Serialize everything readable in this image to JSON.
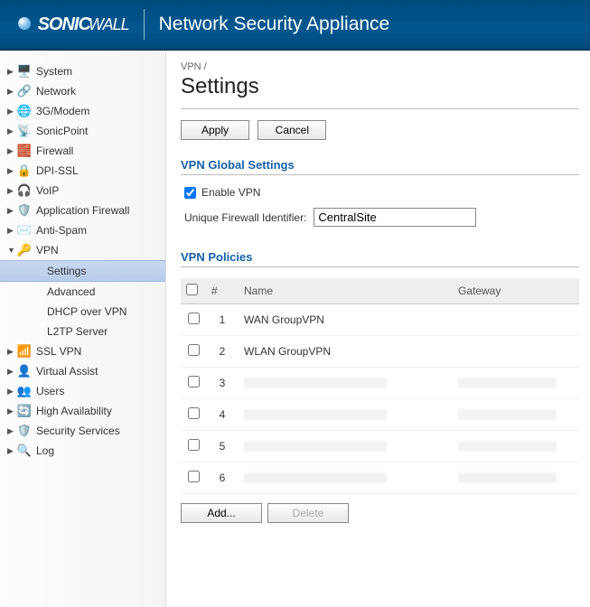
{
  "header": {
    "brand": "SONIC",
    "brand_suffix": "WALL",
    "subtitle": "Network Security Appliance"
  },
  "sidebar": {
    "items": [
      {
        "label": "System",
        "icon": "🖥️"
      },
      {
        "label": "Network",
        "icon": "🔗"
      },
      {
        "label": "3G/Modem",
        "icon": "🌐"
      },
      {
        "label": "SonicPoint",
        "icon": "📡"
      },
      {
        "label": "Firewall",
        "icon": "🧱"
      },
      {
        "label": "DPI-SSL",
        "icon": "🔒"
      },
      {
        "label": "VoIP",
        "icon": "🎧"
      },
      {
        "label": "Application Firewall",
        "icon": "🛡️"
      },
      {
        "label": "Anti-Spam",
        "icon": "✉️"
      },
      {
        "label": "VPN",
        "icon": "🔑",
        "expanded": true,
        "subs": [
          {
            "label": "Settings",
            "active": true
          },
          {
            "label": "Advanced"
          },
          {
            "label": "DHCP over VPN"
          },
          {
            "label": "L2TP Server"
          }
        ]
      },
      {
        "label": "SSL VPN",
        "icon": "📶"
      },
      {
        "label": "Virtual Assist",
        "icon": "👤"
      },
      {
        "label": "Users",
        "icon": "👥"
      },
      {
        "label": "High Availability",
        "icon": "🔄"
      },
      {
        "label": "Security Services",
        "icon": "🛡️"
      },
      {
        "label": "Log",
        "icon": "🔍"
      }
    ]
  },
  "main": {
    "breadcrumb": "VPN /",
    "title": "Settings",
    "buttons": {
      "apply": "Apply",
      "cancel": "Cancel"
    },
    "global": {
      "heading": "VPN Global Settings",
      "enable_label": "Enable VPN",
      "enable_checked": true,
      "uid_label": "Unique Firewall Identifier:",
      "uid_value": "CentralSite"
    },
    "policies": {
      "heading": "VPN Policies",
      "columns": {
        "num": "#",
        "name": "Name",
        "gateway": "Gateway"
      },
      "rows": [
        {
          "num": "1",
          "name": "WAN GroupVPN",
          "gateway": "",
          "redacted": false
        },
        {
          "num": "2",
          "name": "WLAN GroupVPN",
          "gateway": "",
          "redacted": false
        },
        {
          "num": "3",
          "name": "",
          "gateway": "",
          "redacted": true
        },
        {
          "num": "4",
          "name": "",
          "gateway": "",
          "redacted": true
        },
        {
          "num": "5",
          "name": "",
          "gateway": "",
          "redacted": true
        },
        {
          "num": "6",
          "name": "",
          "gateway": "",
          "redacted": true
        }
      ],
      "footer": {
        "add": "Add...",
        "delete": "Delete"
      }
    }
  }
}
